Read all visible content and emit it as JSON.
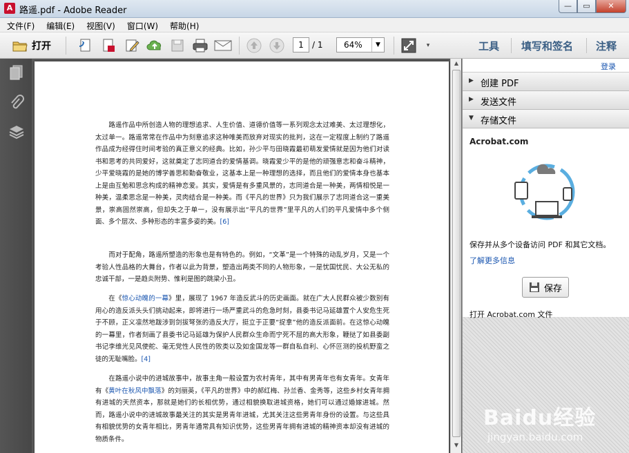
{
  "window": {
    "title": "路遥.pdf - Adobe Reader",
    "app_icon_glyph": "A"
  },
  "menu": [
    "文件(F)",
    "编辑(E)",
    "视图(V)",
    "窗口(W)",
    "帮助(H)"
  ],
  "toolbar": {
    "open_label": "打开",
    "page_current": "1",
    "page_total": "/ 1",
    "zoom": "64%",
    "tools_label": "工具",
    "fill_sign_label": "填写和签名",
    "comment_label": "注释"
  },
  "right_panel": {
    "login": "登录",
    "sections": [
      {
        "label": "创建 PDF",
        "expanded": false
      },
      {
        "label": "发送文件",
        "expanded": false
      },
      {
        "label": "存储文件",
        "expanded": true
      }
    ],
    "store": {
      "acrobat_title": "Acrobat.com",
      "description": "保存并从多个设备访问 PDF 和其它文档。",
      "learn_more": "了解更多信息",
      "save_button": "保存",
      "open_acrobat": "打开 Acrobat.com 文件"
    }
  },
  "document": {
    "paragraphs": [
      [
        {
          "t": "　　路遥作品中所创造人物的理想追求、人生价值、道德价值等一系列观念太过难美、太过理想化，太过单一。路遥常常在作品中为刻意追求这种唯美而放弃对现实的批判，这在一定程度上制约了路遥作品成为经得住时间考验的真正意义的经典。比如，孙少平与田晓霞最初萌发爱情就是因为他们对读书和思考的共同爱好，这就奠定了志同道合的爱情基调。晓霞爱少平的是他的顽强意志和奋斗精神，少平爱晓霞的是她的博学善思和勤奋敬业，这基本上是一种理想的选择，而且他们的爱情本身也基本上是由互勉和思念构成的精神恋爱。其实，爱情是有多重风景的，志同道合是一种美，两情相悦是一种美，温柔思念是一种美，灵肉结合是一种美。而《平凡的世界》只为我们展示了志同道合这一重美景，崇高固然崇高，但却失之于单一，没有展示出“平凡的世界”里平凡的人们的平凡爱情中多个侧面、多个层次、多种形态的丰富多姿的美。"
        },
        {
          "t": "[6]",
          "link": true
        }
      ],
      [
        {
          "t": "　　而对于配角，路遥所塑造的形象也是有特色的。例如，“文革”是一个特殊的动乱岁月，又是一个考验人性品格的大舞台，作者以此为背景，塑造出两类不同的人物形象，一是忧国忧民、大公无私的忠诚干部，一是趋炎附势、惟利是图的跳梁小丑。"
        }
      ],
      [
        {
          "t": "　　在《"
        },
        {
          "t": "惊心动魄的一幕",
          "link": true
        },
        {
          "t": "》里，展现了 1967 年造反武斗的历史画面。就在广大人民群众被少数别有用心的造反派头头们挑动起来，即将进行一场严重武斗的危急时刻，县委书记马延雄置个人安危生死于不顾，正义凛然地跋涉到剑拔弩张的造反大厅，挺立于正要“捉拿”他的造反派面前。在这惊心动魄的一幕里，作者刻画了县委书记马延雄为保护人民群众生命而宁死不屈的高大形象，鞭挞了如县委副书记李维光见风使舵、毫无党性人民性的败类以及如金国龙等一群自私自利、心怀叵测的投机野蛮之徒的无耻嘴脸。"
        },
        {
          "t": "[4]",
          "link": true
        }
      ],
      [
        {
          "t": "　　在路遥小说中的进城故事中，故事主角一般设置为农村青年，其中有男青年也有女青年。女青年有《"
        },
        {
          "t": "黄叶在秋风中飘落",
          "link": true
        },
        {
          "t": "》的刘丽英，《平凡的世界》中的郝红梅、孙兰香、金秀等，这些乡村女青年拥有进城的天然资本，那就是她们的长相优势，通过相貌换取进城资格，她们可以通过婚嫁进城。然而，路遥小说中的进城故事最关注的其实是男青年进城，尤其关注这些男青年身份的设置。与这些具有相貌优势的女青年相比，男青年通常具有知识优势，这些男青年拥有进城的精神资本却没有进城的物质条件。"
        }
      ]
    ]
  },
  "watermark": {
    "brand": "Baidu经验",
    "url": "jingyan.baidu.com"
  }
}
